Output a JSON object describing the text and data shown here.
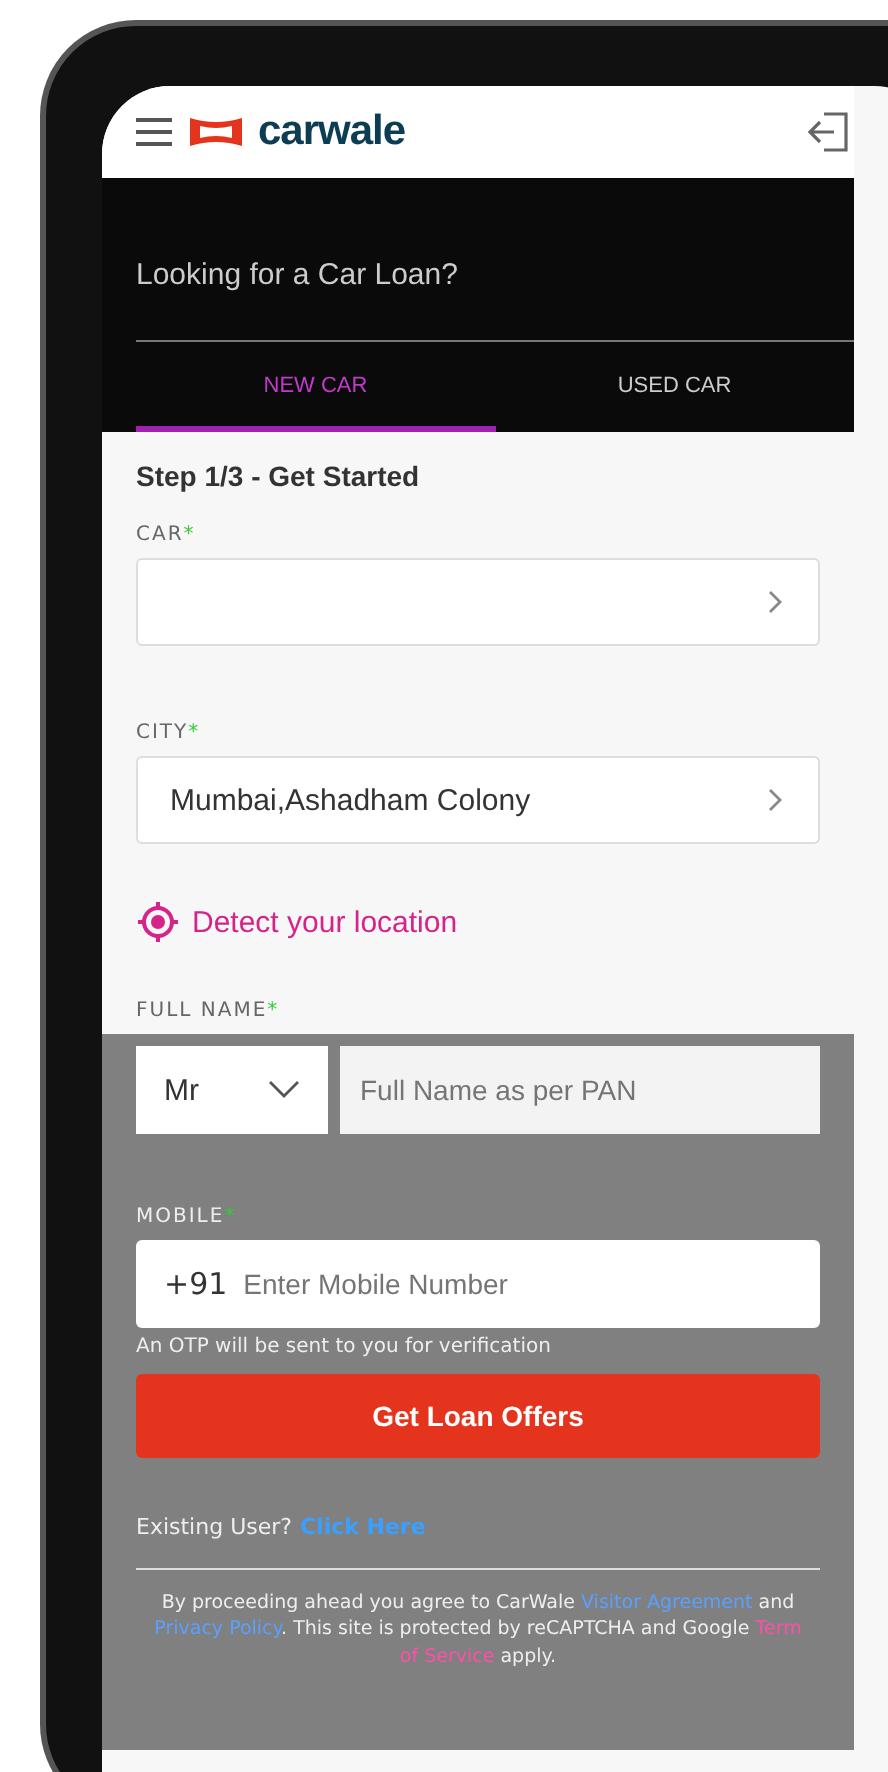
{
  "header": {
    "logo": "carwale"
  },
  "hero": {
    "title": "Looking for a Car Loan?"
  },
  "tabs": [
    {
      "label": "NEW CAR",
      "selected": true
    },
    {
      "label": "USED CAR",
      "selected": false
    }
  ],
  "form": {
    "step": "Step 1/3 - Get Started",
    "car": {
      "label": "CAR",
      "required_mark": "*"
    },
    "city": {
      "label": "CITY",
      "required_mark": "*",
      "value": "Mumbai,Ashadham Colony"
    },
    "detect_location": "Detect your location",
    "full_name": {
      "label": "FULL NAME",
      "required_mark": "*",
      "salutation": "Mr",
      "placeholder": "Full Name as per PAN"
    },
    "mobile": {
      "label": "MOBILE",
      "required_mark": "*",
      "prefix": "+91",
      "placeholder": "Enter Mobile Number",
      "hint": "An OTP will be sent to you for verification"
    },
    "submit": "Get Loan Offers",
    "existing_user": {
      "text": "Existing User?",
      "link": "Click Here"
    },
    "legal": [
      {
        "kind": "text",
        "text": "By proceeding ahead you agree to CarWale "
      },
      {
        "kind": "link",
        "text": "Visitor Agreement"
      },
      {
        "kind": "text",
        "text": " and "
      },
      {
        "kind": "link",
        "text": "Privacy Policy"
      },
      {
        "kind": "text",
        "text": ". This site is protected by reCAPTCHA and Google "
      },
      {
        "kind": "link",
        "text": "Term"
      },
      {
        "kind": "link",
        "text": "of Service"
      },
      {
        "kind": "text",
        "text": " apply."
      }
    ]
  }
}
